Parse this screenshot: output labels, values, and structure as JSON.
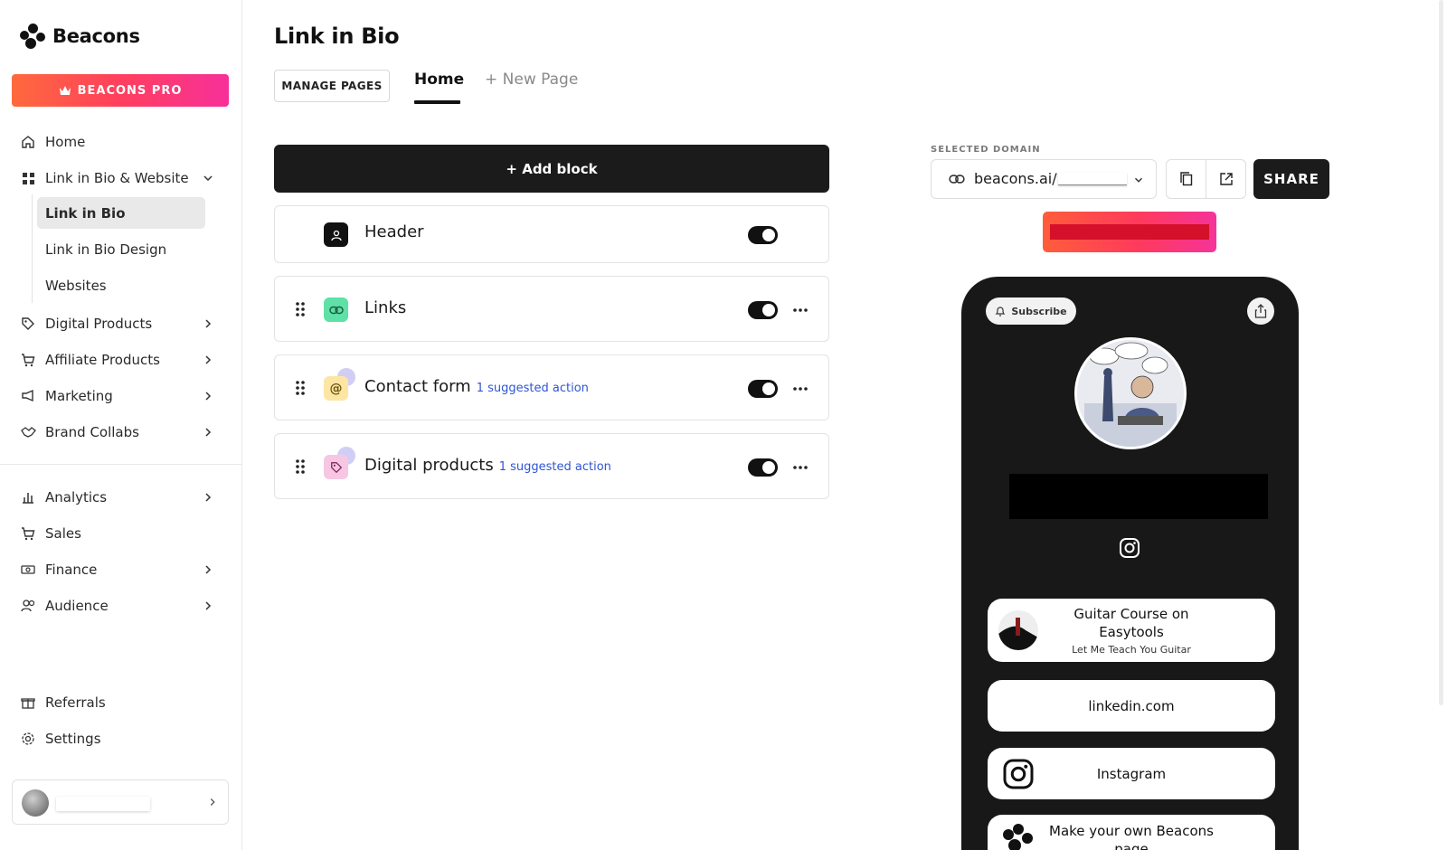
{
  "brand": {
    "name": "Beacons",
    "pro_label": "BEACONS PRO"
  },
  "sidebar": {
    "items": [
      {
        "label": "Home",
        "icon": "home-icon"
      },
      {
        "label": "Link in Bio & Website",
        "icon": "grid-icon",
        "expanded": true
      },
      {
        "label": "Digital Products",
        "icon": "tag-icon"
      },
      {
        "label": "Affiliate Products",
        "icon": "cart-icon"
      },
      {
        "label": "Marketing",
        "icon": "megaphone-icon"
      },
      {
        "label": "Brand Collabs",
        "icon": "handshake-icon"
      },
      {
        "label": "Analytics",
        "icon": "bar-chart-icon"
      },
      {
        "label": "Sales",
        "icon": "cart-icon"
      },
      {
        "label": "Finance",
        "icon": "money-icon"
      },
      {
        "label": "Audience",
        "icon": "people-icon"
      },
      {
        "label": "Referrals",
        "icon": "gift-icon"
      },
      {
        "label": "Settings",
        "icon": "gear-icon"
      }
    ],
    "subitems": [
      {
        "label": "Link in Bio",
        "active": true
      },
      {
        "label": "Link in Bio Design"
      },
      {
        "label": "Websites"
      }
    ]
  },
  "main": {
    "title": "Link in Bio",
    "manage_pages": "MANAGE PAGES",
    "tabs": {
      "home": "Home",
      "new_page": "+ New Page"
    },
    "add_block": "+ Add block",
    "blocks": [
      {
        "title": "Header",
        "enabled": true
      },
      {
        "title": "Links",
        "enabled": true
      },
      {
        "title": "Contact form",
        "suggestion": "1 suggested action",
        "enabled": true
      },
      {
        "title": "Digital products",
        "suggestion": "1 suggested action",
        "enabled": true
      }
    ]
  },
  "right_panel": {
    "selected_domain_label": "SELECTED DOMAIN",
    "domain": "beacons.ai/",
    "share": "SHARE"
  },
  "phone": {
    "subscribe": "Subscribe",
    "links": [
      {
        "title": "Guitar Course on Easytools",
        "subtitle": "Let Me Teach You Guitar"
      },
      {
        "title": "linkedin.com"
      },
      {
        "title": "Instagram"
      },
      {
        "title": "Make your own Beacons page"
      }
    ]
  },
  "colors": {
    "accent_dark": "#1b1b1b",
    "pro_gradient_start": "#ff6a3d",
    "pro_gradient_end": "#f7309a",
    "suggestion_blue": "#2f55d4"
  }
}
